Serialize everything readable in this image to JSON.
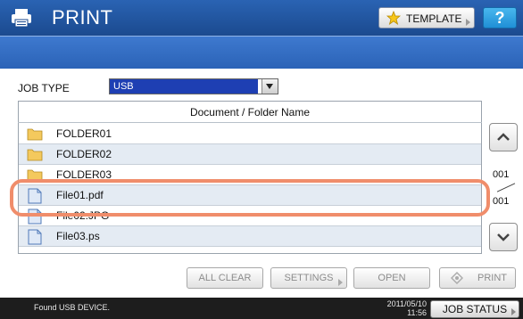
{
  "header": {
    "title": "PRINT",
    "template_label": "TEMPLATE",
    "help_label": "?"
  },
  "job_type": {
    "label": "JOB TYPE",
    "selected": "USB"
  },
  "list": {
    "column_header": "Document / Folder Name",
    "items": [
      {
        "name": "FOLDER01",
        "type": "folder"
      },
      {
        "name": "FOLDER02",
        "type": "folder"
      },
      {
        "name": "FOLDER03",
        "type": "folder"
      },
      {
        "name": "File01.pdf",
        "type": "file"
      },
      {
        "name": "File02.JPG",
        "type": "file"
      },
      {
        "name": "File03.ps",
        "type": "file"
      }
    ]
  },
  "pager": {
    "current": "001",
    "total": "001"
  },
  "buttons": {
    "all_clear": "ALL CLEAR",
    "settings": "SETTINGS",
    "open": "OPEN",
    "print": "PRINT"
  },
  "status": {
    "message": "Found USB DEVICE.",
    "date": "2011/05/10",
    "time": "11:56",
    "job_status": "JOB STATUS"
  },
  "colors": {
    "title_bar": "#1b4a8f",
    "selection": "#1e3fb3",
    "highlight_ring": "#f08d6b",
    "help_button": "#1f8fd6"
  }
}
